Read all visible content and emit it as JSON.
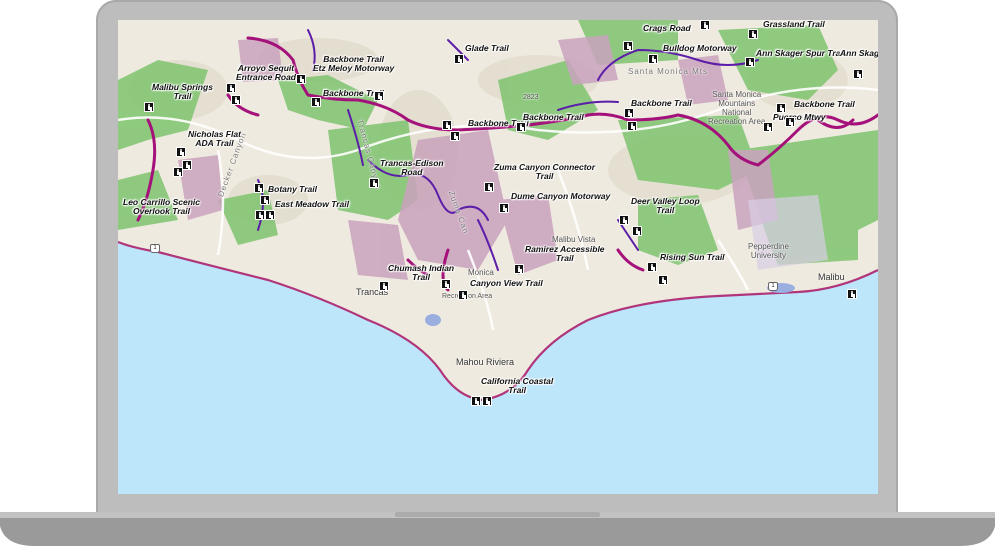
{
  "map": {
    "trails": [
      {
        "id": "t1",
        "name": "Malibu Springs\nTrail"
      },
      {
        "id": "t2",
        "name": "Arroyo Sequit\nEntrance Road"
      },
      {
        "id": "t3",
        "name": "Backbone Trail\nEtz Meloy Motorway"
      },
      {
        "id": "t4",
        "name": "Backbone Trail"
      },
      {
        "id": "t5",
        "name": "Glade Trail"
      },
      {
        "id": "t6",
        "name": "Crags Road"
      },
      {
        "id": "t7",
        "name": "Bulldog Motorway"
      },
      {
        "id": "t8",
        "name": "Grassland Trail"
      },
      {
        "id": "t9",
        "name": "Ann Skager Spur Trail"
      },
      {
        "id": "t10",
        "name": "Ann Skager"
      },
      {
        "id": "t11",
        "name": "Nicholas Flat\nADA Trail"
      },
      {
        "id": "t12",
        "name": "Backbone Trail"
      },
      {
        "id": "t13",
        "name": "Backbone Trail"
      },
      {
        "id": "t14",
        "name": "Backbone Trail"
      },
      {
        "id": "t15",
        "name": "Backbone Trail"
      },
      {
        "id": "t16",
        "name": "Puerco Mtwy"
      },
      {
        "id": "t17",
        "name": "Trancas-Edison\nRoad"
      },
      {
        "id": "t18",
        "name": "Zuma Canyon Connector\nTrail"
      },
      {
        "id": "t19",
        "name": "Botany Trail"
      },
      {
        "id": "t20",
        "name": "East Meadow Trail"
      },
      {
        "id": "t21",
        "name": "Leo Carrillo Scenic\nOverlook Trail"
      },
      {
        "id": "t22",
        "name": "Dume Canyon Motorway"
      },
      {
        "id": "t23",
        "name": "Deer Valley Loop\nTrail"
      },
      {
        "id": "t24",
        "name": "Ramirez Accessible\nTrail"
      },
      {
        "id": "t25",
        "name": "Rising Sun Trail"
      },
      {
        "id": "t26",
        "name": "Chumash Indian\nTrail"
      },
      {
        "id": "t27",
        "name": "Canyon View Trail"
      },
      {
        "id": "t28",
        "name": "California Coastal\nTrail"
      }
    ],
    "places": [
      {
        "id": "p1",
        "name": "Malibu Vista"
      },
      {
        "id": "p2",
        "name": "Pepperdine\nUniversity"
      },
      {
        "id": "p3",
        "name": "Malibu"
      },
      {
        "id": "p4",
        "name": "Trancas"
      },
      {
        "id": "p5",
        "name": "Mahou Riviera"
      },
      {
        "id": "p6",
        "name": "Santa Monica\nMountains\nNational\nRecreation Area"
      },
      {
        "id": "p7",
        "name": "Santa Monica Mts"
      },
      {
        "id": "p8",
        "name": "Decker Canyon"
      },
      {
        "id": "p9",
        "name": "Trancas Canyon"
      },
      {
        "id": "p10",
        "name": "Zuma Can"
      },
      {
        "id": "p11",
        "name": "Monica"
      },
      {
        "id": "p12",
        "name": "Recreation Area"
      },
      {
        "id": "p13",
        "name": "2823"
      }
    ],
    "route_shield": "1",
    "colors": {
      "ocean": "#bde6fb",
      "land": "#efeadf",
      "park_green": "#7ec46f",
      "private_mauve": "#c9a2bd",
      "trail_magenta": "#a4117a",
      "trail_purple": "#5c1ea8",
      "coastline": "#b0357a"
    }
  }
}
